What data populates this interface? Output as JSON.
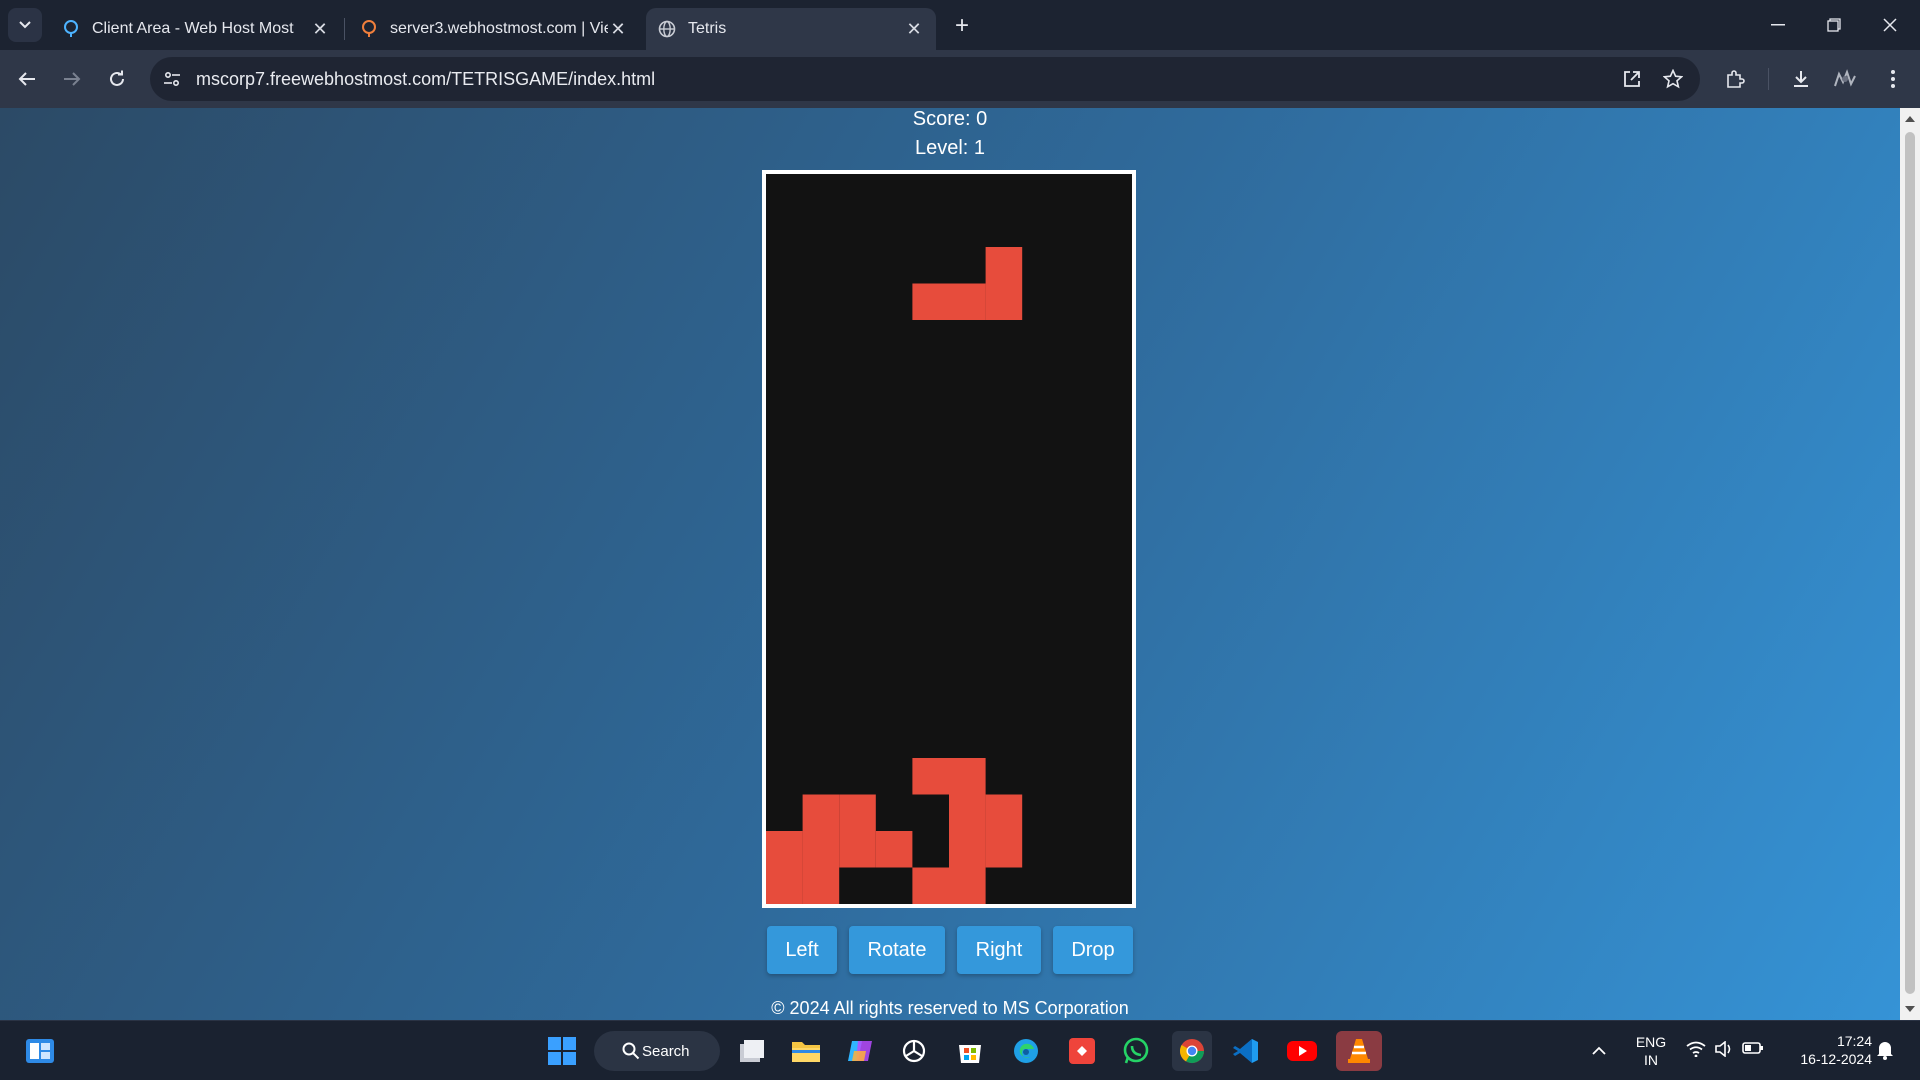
{
  "browser": {
    "tabs": [
      {
        "title": "Client Area - Web Host Most",
        "active": false
      },
      {
        "title": "server3.webhostmost.com | Vie",
        "active": false
      },
      {
        "title": "Tetris",
        "active": true
      }
    ],
    "url": "mscorp7.freewebhostmost.com/TETRISGAME/index.html"
  },
  "game": {
    "score_text": "Score: 0",
    "level_text": "Level: 1",
    "piece_color": "#e74c3c",
    "board_bg": "#121212",
    "grid": {
      "cols": 10,
      "rows": 20
    },
    "falling_piece": {
      "name": "L",
      "cells": [
        [
          6,
          2
        ],
        [
          4,
          3
        ],
        [
          5,
          3
        ],
        [
          6,
          3
        ]
      ]
    },
    "locked_cells": [
      [
        4,
        16
      ],
      [
        5,
        16
      ],
      [
        1,
        17
      ],
      [
        2,
        17
      ],
      [
        5,
        17
      ],
      [
        6,
        17
      ],
      [
        0,
        18
      ],
      [
        1,
        18
      ],
      [
        2,
        18
      ],
      [
        3,
        18
      ],
      [
        5,
        18
      ],
      [
        6,
        18
      ],
      [
        0,
        19
      ],
      [
        1,
        19
      ],
      [
        4,
        19
      ],
      [
        5,
        19
      ]
    ],
    "buttons": {
      "left": "Left",
      "rotate": "Rotate",
      "right": "Right",
      "drop": "Drop"
    },
    "button_color": "#3498db"
  },
  "footer": "© 2024 All rights reserved to MS Corporation",
  "taskbar": {
    "search_label": "Search",
    "lang_top": "ENG",
    "lang_bottom": "IN",
    "time": "17:24",
    "date": "16-12-2024",
    "apps": [
      "task-view-icon",
      "file-explorer-icon",
      "copilot-icon",
      "chatgpt-icon",
      "ms-store-icon",
      "edge-icon",
      "anydesk-icon",
      "whatsapp-icon",
      "chrome-icon",
      "vscode-icon",
      "youtube-icon",
      "vlc-icon"
    ]
  }
}
